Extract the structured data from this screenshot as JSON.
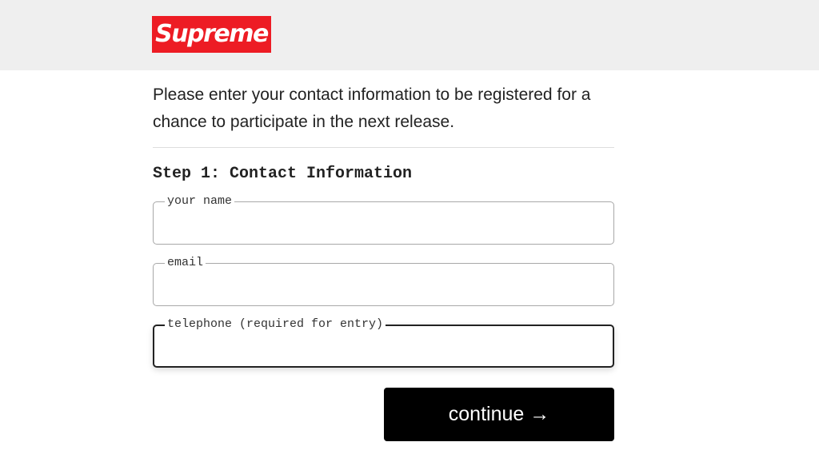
{
  "brand": {
    "logo_text": "Supreme",
    "logo_color": "#ed1c24"
  },
  "intro_text": "Please enter your contact information to be registered for a chance to participate in the next release.",
  "step": {
    "title": "Step 1: Contact Information"
  },
  "fields": {
    "name": {
      "label": "your name",
      "value": ""
    },
    "email": {
      "label": "email",
      "value": ""
    },
    "telephone": {
      "label": "telephone (required for entry)",
      "value": ""
    }
  },
  "continue_button": {
    "label": "continue →"
  }
}
